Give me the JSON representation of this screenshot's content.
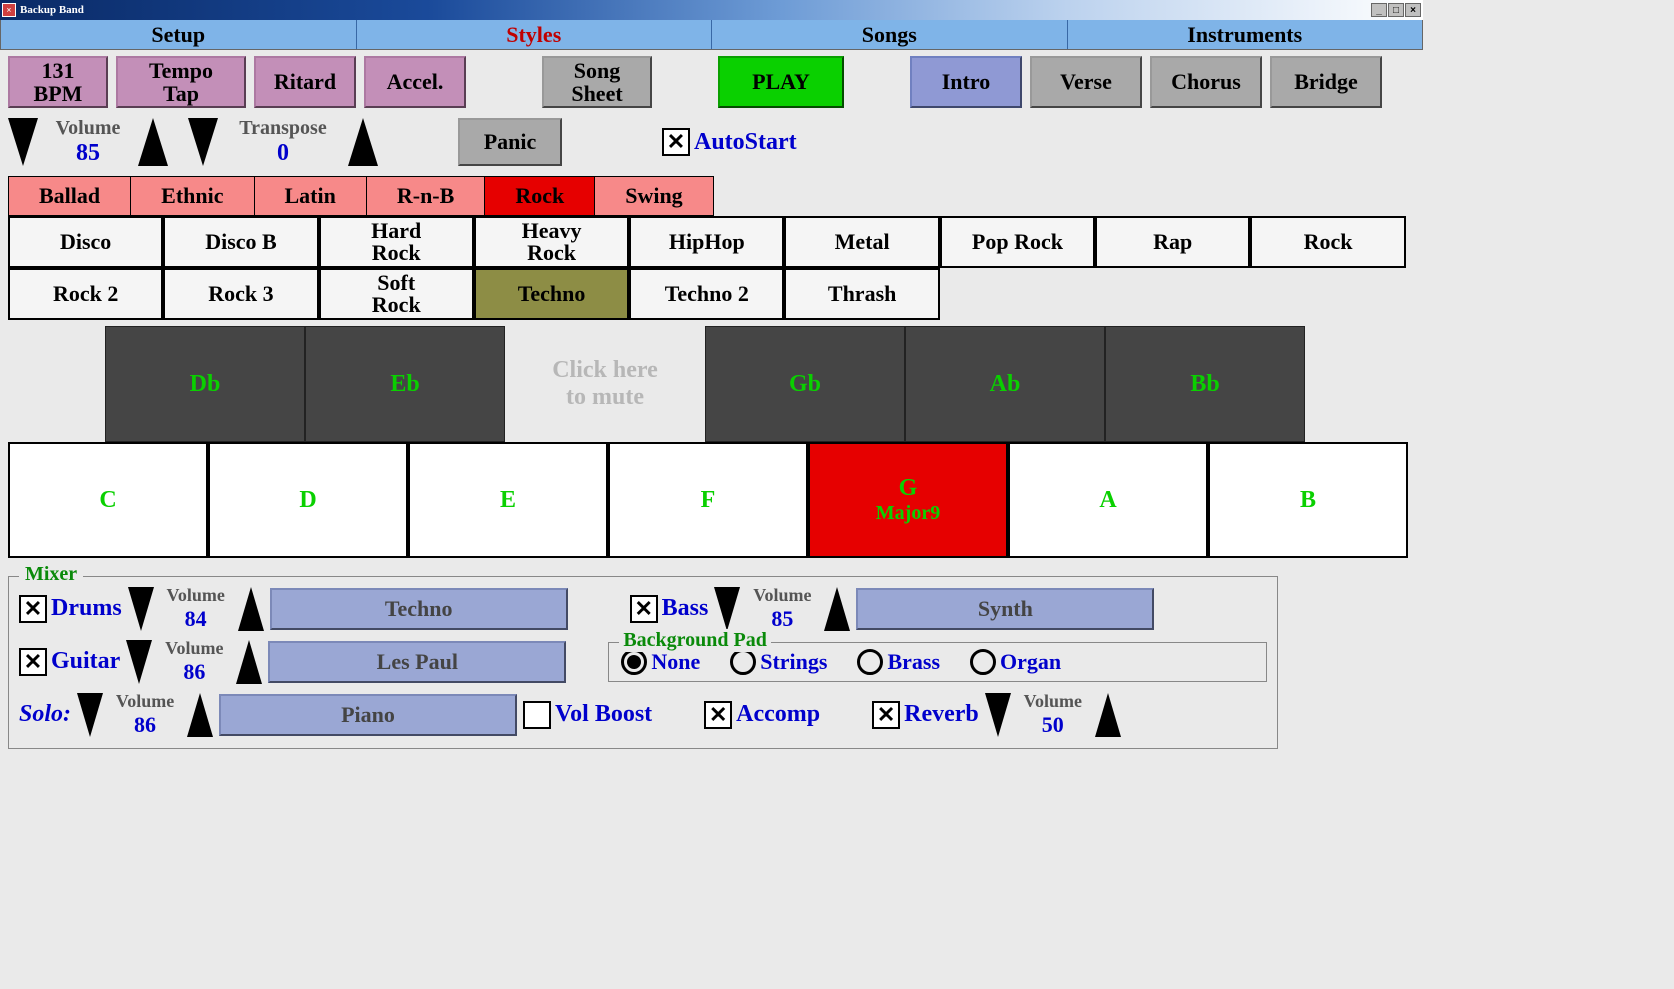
{
  "window": {
    "title": "Backup Band"
  },
  "menu": {
    "items": [
      "Setup",
      "Styles",
      "Songs",
      "Instruments"
    ],
    "active": 1
  },
  "toolbar": {
    "bpm_line1": "131",
    "bpm_line2": "BPM",
    "tap_line1": "Tempo",
    "tap_line2": "Tap",
    "ritard": "Ritard",
    "accel": "Accel.",
    "sheet_line1": "Song",
    "sheet_line2": "Sheet",
    "play": "PLAY",
    "intro": "Intro",
    "verse": "Verse",
    "chorus": "Chorus",
    "bridge": "Bridge"
  },
  "volume": {
    "label": "Volume",
    "value": "85"
  },
  "transpose": {
    "label": "Transpose",
    "value": "0"
  },
  "panic": "Panic",
  "autostart": {
    "label": "AutoStart",
    "checked": true
  },
  "categories": [
    "Ballad",
    "Ethnic",
    "Latin",
    "R-n-B",
    "Rock",
    "Swing"
  ],
  "category_selected": 4,
  "styles": [
    "Disco",
    "Disco B",
    "Hard Rock",
    "Heavy Rock",
    "HipHop",
    "Metal",
    "Pop Rock",
    "Rap",
    "Rock",
    "Rock 2",
    "Rock 3",
    "Soft Rock",
    "Techno",
    "Techno 2",
    "Thrash"
  ],
  "style_selected": 12,
  "keyboard": {
    "black": [
      "Db",
      "Eb",
      "",
      "Gb",
      "Ab",
      "Bb"
    ],
    "mute_line1": "Click here",
    "mute_line2": "to mute",
    "white": [
      "C",
      "D",
      "E",
      "F",
      "G",
      "A",
      "B"
    ],
    "white_sub": [
      "",
      "",
      "",
      "",
      "Major9",
      "",
      ""
    ],
    "white_selected": 4
  },
  "mixer": {
    "title": "Mixer",
    "drums": {
      "label": "Drums",
      "checked": true,
      "vol_label": "Volume",
      "vol": "84",
      "patch": "Techno"
    },
    "bass": {
      "label": "Bass",
      "checked": true,
      "vol_label": "Volume",
      "vol": "85",
      "patch": "Synth"
    },
    "guitar": {
      "label": "Guitar",
      "checked": true,
      "vol_label": "Volume",
      "vol": "86",
      "patch": "Les Paul"
    },
    "pad": {
      "title": "Background Pad",
      "options": [
        "None",
        "Strings",
        "Brass",
        "Organ"
      ],
      "selected": 0
    },
    "solo": {
      "label": "Solo:",
      "vol_label": "Volume",
      "vol": "86",
      "patch": "Piano"
    },
    "volboost": {
      "label": "Vol Boost",
      "checked": false
    },
    "accomp": {
      "label": "Accomp",
      "checked": true
    },
    "reverb": {
      "label": "Reverb",
      "checked": true,
      "vol_label": "Volume",
      "vol": "50"
    }
  }
}
